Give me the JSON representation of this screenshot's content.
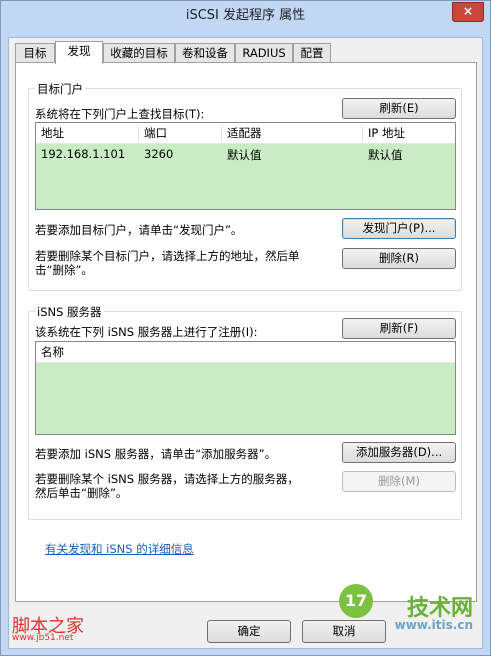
{
  "window": {
    "title": "iSCSI 发起程序 属性",
    "close_symbol": "×"
  },
  "tabs": [
    {
      "label": "目标",
      "active": false
    },
    {
      "label": "发现",
      "active": true
    },
    {
      "label": "收藏的目标",
      "active": false
    },
    {
      "label": "卷和设备",
      "active": false
    },
    {
      "label": "RADIUS",
      "active": false
    },
    {
      "label": "配置",
      "active": false
    }
  ],
  "target_portals": {
    "group_title": "目标门户",
    "description": "系统将在下列门户上查找目标(T):",
    "refresh_button": "刷新(E)",
    "columns": [
      "地址",
      "端口",
      "适配器",
      "IP 地址"
    ],
    "rows": [
      {
        "address": "192.168.1.101",
        "port": "3260",
        "adapter": "默认值",
        "ip": "默认值"
      }
    ],
    "add_text": "若要添加目标门户，请单击“发现门户”。",
    "discover_button": "发现门户(P)...",
    "remove_text_line1": "若要删除某个目标门户，请选择上方的地址，然后单",
    "remove_text_line2": "击“删除”。",
    "remove_button": "删除(R)"
  },
  "isns": {
    "group_title": "iSNS 服务器",
    "description": "该系统在下列 iSNS 服务器上进行了注册(I):",
    "refresh_button": "刷新(F)",
    "columns": [
      "名称"
    ],
    "add_text": "若要添加 iSNS 服务器，请单击“添加服务器”。",
    "add_button": "添加服务器(D)...",
    "remove_text_line1": "若要删除某个 iSNS 服务器，请选择上方的服务器，",
    "remove_text_line2": "然后单击“删除”。",
    "remove_button": "删除(M)"
  },
  "more_info_link": "有关发现和 iSNS 的详细信息",
  "footer": {
    "ok_button": "确定",
    "cancel_button": "取消"
  },
  "watermarks": {
    "left": "脚本之家",
    "left_sub": "www.jb51.net",
    "right_logo": "17",
    "right": "技术网",
    "right_sub": "www.itis.cn"
  }
}
